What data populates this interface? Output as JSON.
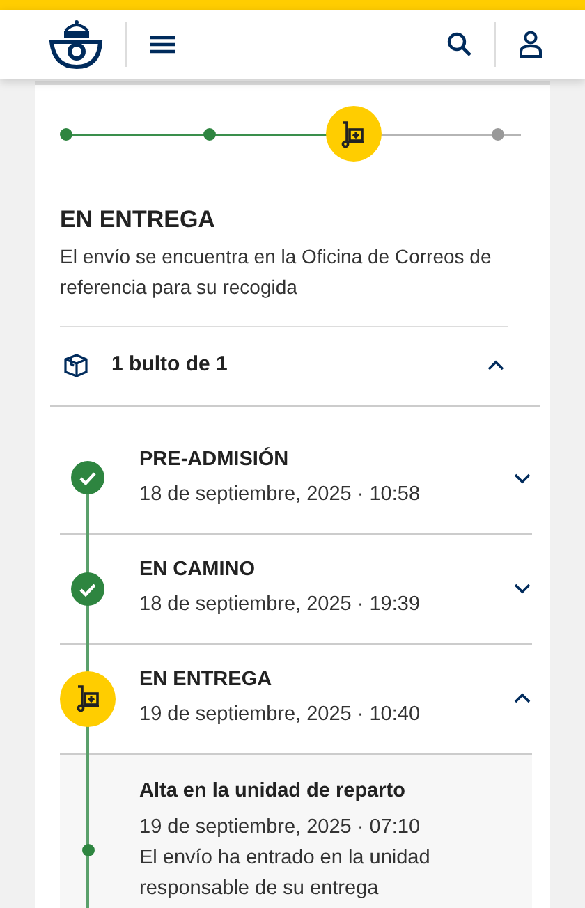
{
  "progress": [
    {
      "current": false
    },
    {
      "current": false
    },
    {
      "current": true
    },
    {
      "current": false
    }
  ],
  "status": {
    "title": "EN ENTREGA",
    "description": "El envío se encuentra en la Oficina de Correos de referencia para su recogida"
  },
  "packages": {
    "label": "1 bulto de 1",
    "expanded": true
  },
  "events": [
    {
      "title": "PRE-ADMISIÓN",
      "date": "18 de septiembre, 2025 · 10:58",
      "current": false,
      "expanded": false
    },
    {
      "title": "EN CAMINO",
      "date": "18 de septiembre, 2025 · 19:39",
      "current": false,
      "expanded": false
    },
    {
      "title": "EN ENTREGA",
      "date": "19 de septiembre, 2025 · 10:40",
      "current": true,
      "expanded": true,
      "details": [
        {
          "title": "Alta en la unidad de reparto",
          "date": "19 de septiembre, 2025 · 07:10",
          "description": "El envío ha entrado en la unidad responsable de su entrega"
        }
      ]
    }
  ]
}
